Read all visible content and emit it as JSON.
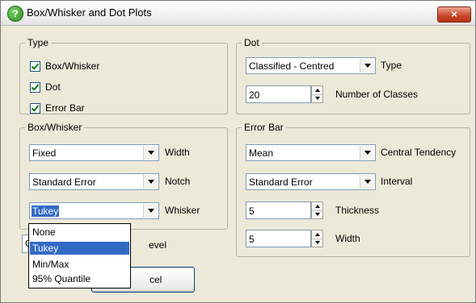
{
  "window": {
    "title": "Box/Whisker and Dot Plots",
    "close_label": "×",
    "icon_label": "?"
  },
  "type_group": {
    "legend": "Type",
    "items": [
      {
        "label": "Box/Whisker",
        "checked": true
      },
      {
        "label": "Dot",
        "checked": true
      },
      {
        "label": "Error Bar",
        "checked": true
      }
    ]
  },
  "dot_group": {
    "legend": "Dot",
    "type_value": "Classified - Centred",
    "type_label": "Type",
    "classes_value": "20",
    "classes_label": "Number of Classes"
  },
  "box_group": {
    "legend": "Box/Whisker",
    "width_value": "Fixed",
    "width_label": "Width",
    "notch_value": "Standard Error",
    "notch_label": "Notch",
    "whisker_value": "Tukey",
    "whisker_label": "Whisker"
  },
  "error_group": {
    "legend": "Error Bar",
    "central_value": "Mean",
    "central_label": "Central Tendency",
    "interval_value": "Standard Error",
    "interval_label": "Interval",
    "thickness_value": "5",
    "thickness_label": "Thickness",
    "width_value": "5",
    "width_label": "Width"
  },
  "hidden_behind": {
    "field_fragment": "C",
    "label_fragment": "evel",
    "button_fragment": "cel"
  },
  "whisker_dropdown": {
    "options": [
      "None",
      "Tukey",
      "Min/Max",
      "95% Quantile"
    ],
    "highlighted": "Tukey"
  }
}
